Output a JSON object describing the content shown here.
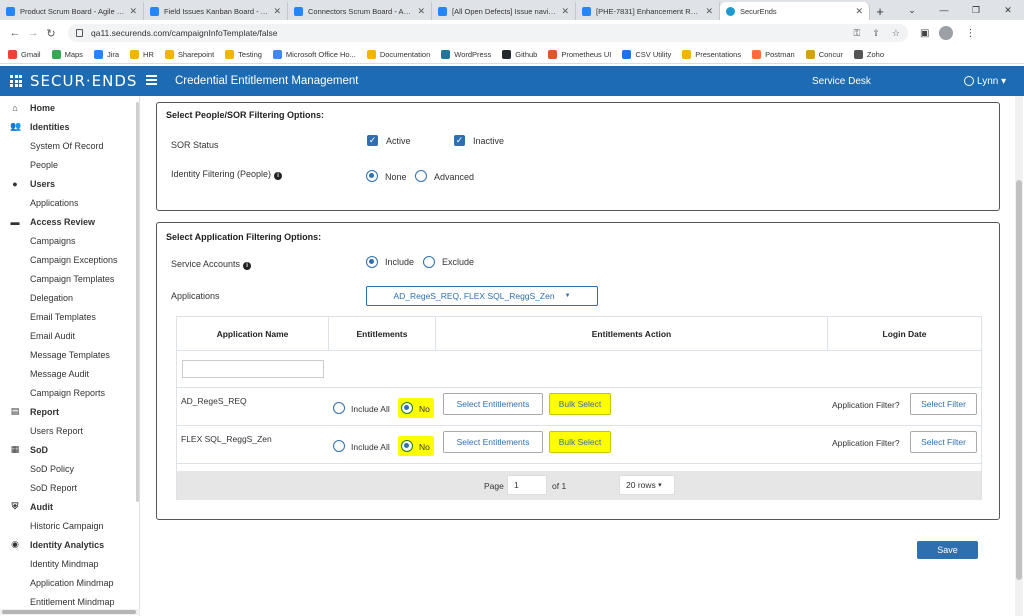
{
  "browser": {
    "tabs": [
      {
        "title": "Product Scrum Board - Agile Bo",
        "active": false
      },
      {
        "title": "Field Issues Kanban Board - Agi",
        "active": false
      },
      {
        "title": "Connectors Scrum Board - Agile",
        "active": false
      },
      {
        "title": "[All Open Defects] Issue navigat",
        "active": false
      },
      {
        "title": "[PHE-7831] Enhancement Reque",
        "active": false
      },
      {
        "title": "SecurEnds",
        "active": true
      }
    ],
    "url": "qa11.securends.com/campaignInfoTemplate/false",
    "bookmarks": [
      "Gmail",
      "Maps",
      "Jira",
      "HR",
      "Sharepoint",
      "Testing",
      "Microsoft Office Ho...",
      "Documentation",
      "WordPress",
      "Github",
      "Prometheus UI",
      "CSV Utility",
      "Presentations",
      "Postman",
      "Concur",
      "Zoho"
    ]
  },
  "header": {
    "logo": "SECUR·ENDS",
    "title": "Credential Entitlement Management",
    "service_desk": "Service Desk",
    "user": "Lynn"
  },
  "sidebar": {
    "items": [
      {
        "label": "Home",
        "type": "section",
        "icon": "home-icon"
      },
      {
        "label": "Identities",
        "type": "section",
        "icon": "people-icon"
      },
      {
        "label": "System Of Record",
        "type": "sub"
      },
      {
        "label": "People",
        "type": "sub"
      },
      {
        "label": "Users",
        "type": "section",
        "icon": "user-icon"
      },
      {
        "label": "Applications",
        "type": "sub"
      },
      {
        "label": "Access Review",
        "type": "section",
        "icon": "review-icon"
      },
      {
        "label": "Campaigns",
        "type": "sub"
      },
      {
        "label": "Campaign Exceptions",
        "type": "sub"
      },
      {
        "label": "Campaign Templates",
        "type": "sub"
      },
      {
        "label": "Delegation",
        "type": "sub"
      },
      {
        "label": "Email Templates",
        "type": "sub"
      },
      {
        "label": "Email Audit",
        "type": "sub"
      },
      {
        "label": "Message Templates",
        "type": "sub"
      },
      {
        "label": "Message Audit",
        "type": "sub"
      },
      {
        "label": "Campaign Reports",
        "type": "sub"
      },
      {
        "label": "Report",
        "type": "section",
        "icon": "report-icon"
      },
      {
        "label": "Users Report",
        "type": "sub"
      },
      {
        "label": "SoD",
        "type": "section",
        "icon": "sod-icon"
      },
      {
        "label": "SoD Policy",
        "type": "sub"
      },
      {
        "label": "SoD Report",
        "type": "sub"
      },
      {
        "label": "Audit",
        "type": "section",
        "icon": "shield-icon"
      },
      {
        "label": "Historic Campaign",
        "type": "sub"
      },
      {
        "label": "Identity Analytics",
        "type": "section",
        "icon": "analytics-icon"
      },
      {
        "label": "Identity Mindmap",
        "type": "sub"
      },
      {
        "label": "Application Mindmap",
        "type": "sub"
      },
      {
        "label": "Entitlement Mindmap",
        "type": "sub"
      }
    ]
  },
  "people_panel": {
    "title": "Select People/SOR Filtering Options:",
    "sor_status_label": "SOR Status",
    "active_label": "Active",
    "inactive_label": "Inactive",
    "identity_filtering_label": "Identity Filtering (People)",
    "none_label": "None",
    "advanced_label": "Advanced"
  },
  "app_panel": {
    "title": "Select Application Filtering Options:",
    "service_accounts_label": "Service Accounts",
    "include_label": "Include",
    "exclude_label": "Exclude",
    "applications_label": "Applications",
    "applications_selected": "AD_RegeS_REQ, FLEX SQL_ReggS_Zen",
    "table": {
      "headers": [
        "Application Name",
        "Entitlements",
        "Entitlements Action",
        "Login Date"
      ],
      "rows": [
        {
          "name": "AD_RegeS_REQ",
          "include_all": "Include All",
          "no": "No",
          "select_entitlements": "Select Entitlements",
          "bulk_select": "Bulk Select",
          "app_filter": "Application Filter?",
          "select_filter": "Select Filter"
        },
        {
          "name": "FLEX SQL_ReggS_Zen",
          "include_all": "Include All",
          "no": "No",
          "select_entitlements": "Select Entitlements",
          "bulk_select": "Bulk Select",
          "app_filter": "Application Filter?",
          "select_filter": "Select Filter"
        }
      ],
      "pager": {
        "page_label": "Page",
        "page": "1",
        "of": "of 1",
        "rows": "20 rows"
      }
    }
  },
  "save_label": "Save",
  "colors": {
    "header_bg": "#1d6bb3",
    "accent": "#2f6fb0",
    "highlight": "#ffff00"
  }
}
